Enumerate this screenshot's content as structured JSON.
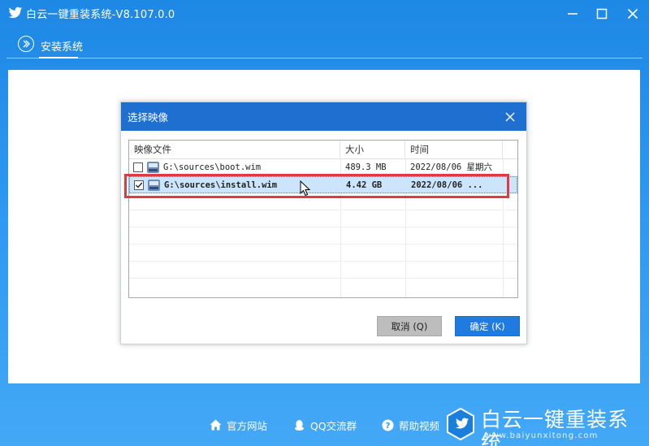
{
  "window": {
    "title": "白云一键重装系统-V8.107.0.0",
    "minimize_icon": "minimize-icon",
    "maximize_icon": "maximize-icon",
    "close_icon": "close-icon"
  },
  "tabs": [
    {
      "label": "安装系统",
      "icon": "chevron-right-circle-icon",
      "active": true
    }
  ],
  "dialog": {
    "title": "选择映像",
    "columns": [
      "映像文件",
      "大小",
      "时间"
    ],
    "rows": [
      {
        "checked": false,
        "file": "G:\\sources\\boot.wim",
        "size": "489.3 MB",
        "time": "2022/08/06 星期六",
        "selected": false
      },
      {
        "checked": true,
        "file": "G:\\sources\\install.wim",
        "size": "4.42 GB",
        "time": "2022/08/06 ...",
        "selected": true
      }
    ],
    "cancel_label": "取消",
    "cancel_hotkey": "(Q)",
    "ok_label": "确定",
    "ok_hotkey": "(K)"
  },
  "footer": {
    "links": [
      {
        "label": "官方网站",
        "icon": "home-icon"
      },
      {
        "label": "QQ交流群",
        "icon": "qq-penguin-icon"
      },
      {
        "label": "帮助视频",
        "icon": "help-circle-icon"
      }
    ],
    "brand_name": "白云一键重装系统",
    "brand_url": "www.baiyunxitong.com"
  },
  "colors": {
    "background": "#2a97ef",
    "dialog_title": "#1f6fd0",
    "ok_button": "#1f7be0",
    "highlight": "#e0393e",
    "selection": "#cce5fb"
  }
}
